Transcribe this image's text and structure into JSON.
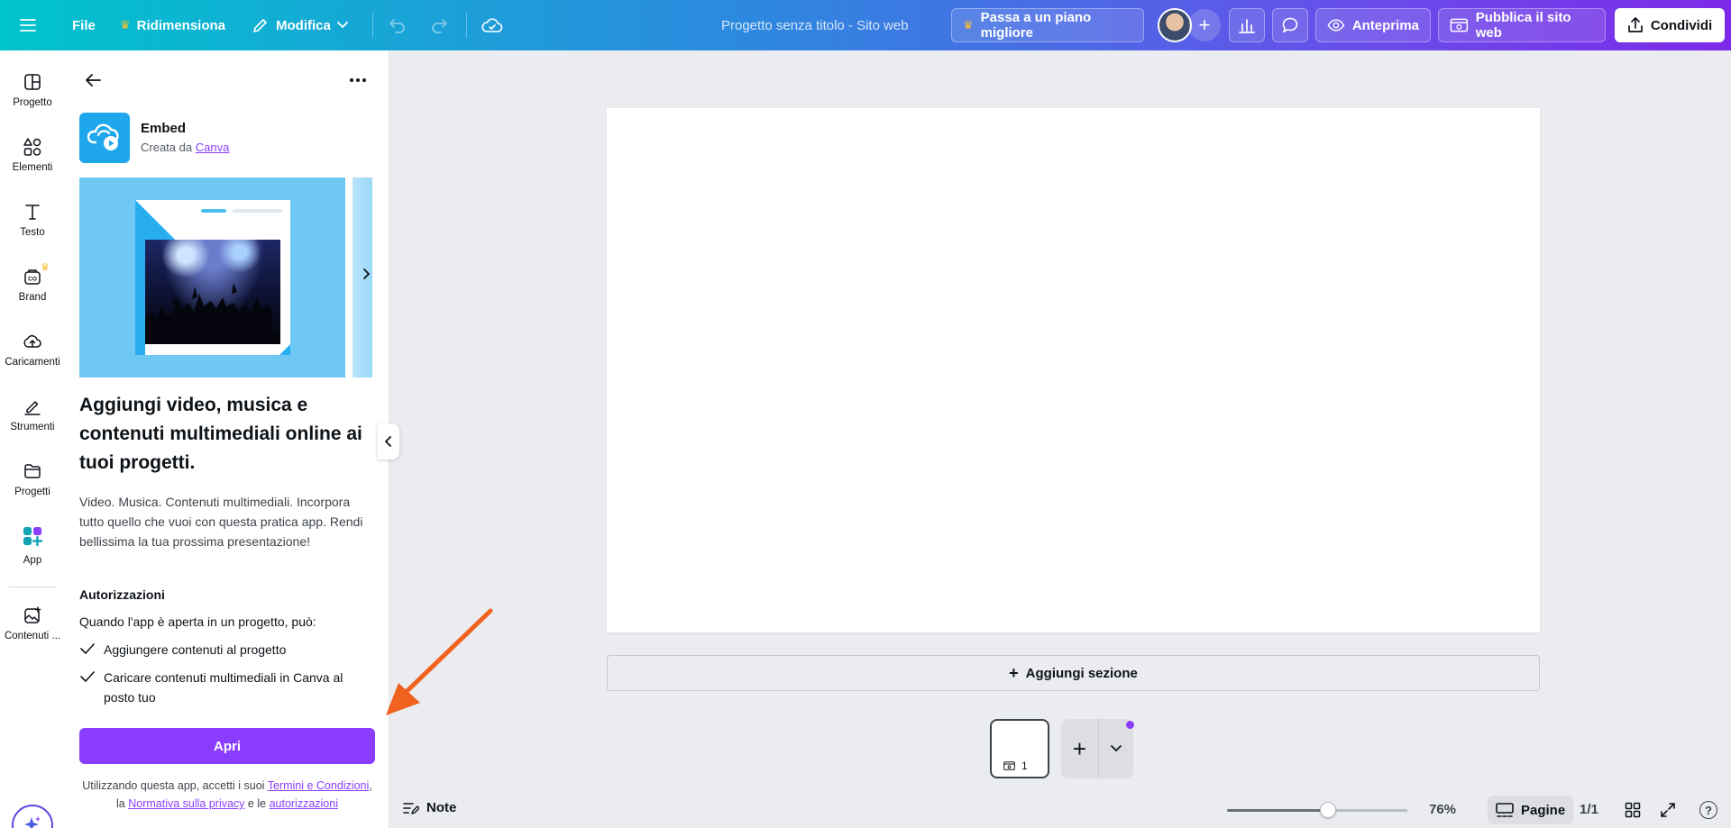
{
  "topbar": {
    "file_label": "File",
    "resize_label": "Ridimensiona",
    "edit_label": "Modifica",
    "doc_title": "Progetto senza titolo - Sito web",
    "upgrade_label": "Passa a un piano migliore",
    "add_label": "+",
    "preview_label": "Anteprima",
    "publish_label": "Pubblica il sito web",
    "share_label": "Condividi"
  },
  "rail": {
    "items": [
      {
        "label": "Progetto",
        "icon": "layout-icon"
      },
      {
        "label": "Elementi",
        "icon": "shapes-icon"
      },
      {
        "label": "Testo",
        "icon": "text-icon"
      },
      {
        "label": "Brand",
        "icon": "brand-icon"
      },
      {
        "label": "Caricamenti",
        "icon": "upload-cloud-icon"
      },
      {
        "label": "Strumenti",
        "icon": "pen-icon"
      },
      {
        "label": "Progetti",
        "icon": "folder-icon"
      },
      {
        "label": "App",
        "icon": "apps-icon"
      },
      {
        "label": "Contenuti ...",
        "icon": "image-plus-icon"
      }
    ]
  },
  "panel": {
    "app_name": "Embed",
    "created_by": "Creata da",
    "creator_link": "Canva",
    "headline": "Aggiungi video, musica e contenuti multimediali online ai tuoi progetti.",
    "description": "Video. Musica. Contenuti multimediali. Incorpora tutto quello che vuoi con questa pratica app. Rendi bellissima la tua prossima presentazione!",
    "permissions_title": "Autorizzazioni",
    "permissions_intro": "Quando l'app è aperta in un progetto, può:",
    "permissions": [
      "Aggiungere contenuti al progetto",
      "Caricare contenuti multimediali in Canva al posto tuo"
    ],
    "open_label": "Apri",
    "terms": {
      "prefix": "Utilizzando questa app, accetti i suoi",
      "terms_link": "Termini e Condizioni",
      "comma": ", la",
      "privacy_link": "Normativa sulla privacy",
      "and": "e le",
      "permissions_link": "autorizzazioni"
    }
  },
  "canvas": {
    "add_section_label": "Aggiungi sezione",
    "page_number": "1"
  },
  "bottombar": {
    "notes_label": "Note",
    "zoom_value": "76%",
    "zoom_fraction": 0.56,
    "pages_label": "Pagine",
    "page_count": "1/1",
    "help_label": "?"
  },
  "colors": {
    "accent": "#8b3dff",
    "app_logo": "#1ea7ec",
    "annotation_arrow": "#f2621f"
  }
}
